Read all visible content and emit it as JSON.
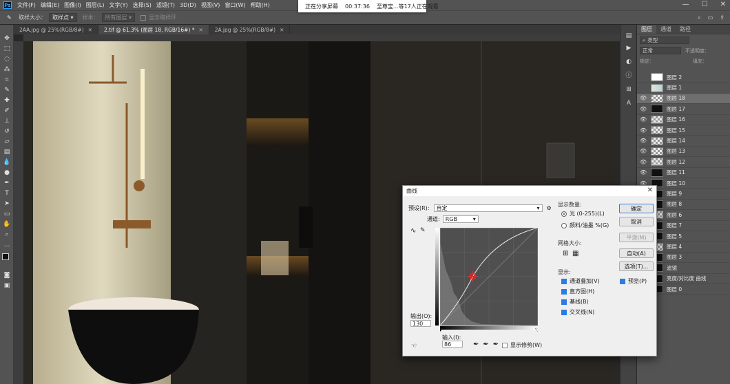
{
  "menu": [
    "文件(F)",
    "编辑(E)",
    "图像(I)",
    "图层(L)",
    "文字(Y)",
    "选择(S)",
    "滤镜(T)",
    "3D(D)",
    "视图(V)",
    "窗口(W)",
    "帮助(H)"
  ],
  "share": {
    "status": "正在分享屏幕",
    "timer": "00:37:36",
    "viewers": "至尊宝...等17人正在观看"
  },
  "options": {
    "sample_size_label": "取样大小：",
    "sample_size_value": "取样点",
    "sample_label": "样本：",
    "sample_value": "所有图层",
    "show_ring": "显示取样环"
  },
  "tabs": [
    {
      "label": "2AA.jpg @ 25%(RGB/8#)"
    },
    {
      "label": "2.tif @ 61.3% (图层 18, RGB/16#) *"
    },
    {
      "label": "2A.jpg @ 25%(RGB/8#)"
    }
  ],
  "layers_panel": {
    "tabs": [
      "图层",
      "通道",
      "路径"
    ],
    "filter": "类型",
    "blend_mode": "正常",
    "opacity_label": "不透明度：",
    "lock_label": "锁定：",
    "fill_label": "填充：",
    "layers": [
      {
        "name": "图层 2",
        "visible": false,
        "thumb": "white"
      },
      {
        "name": "图层 1",
        "visible": false,
        "thumb": "light"
      },
      {
        "name": "图层 18",
        "visible": true,
        "thumb": "check",
        "selected": true
      },
      {
        "name": "图层 17",
        "visible": true,
        "thumb": "dark"
      },
      {
        "name": "图层 16",
        "visible": true,
        "thumb": "check"
      },
      {
        "name": "图层 15",
        "visible": true,
        "thumb": "check"
      },
      {
        "name": "图层 14",
        "visible": true,
        "thumb": "check"
      },
      {
        "name": "图层 13",
        "visible": true,
        "thumb": "check"
      },
      {
        "name": "图层 12",
        "visible": true,
        "thumb": "check"
      },
      {
        "name": "图层 11",
        "visible": true,
        "thumb": "dark"
      },
      {
        "name": "图层 10",
        "visible": true,
        "thumb": "dark"
      },
      {
        "name": "图层 9",
        "visible": true,
        "thumb": "dark"
      },
      {
        "name": "图层 8",
        "visible": true,
        "thumb": "dark"
      },
      {
        "name": "图层 6",
        "visible": true,
        "thumb": "check"
      },
      {
        "name": "图层 7",
        "visible": true,
        "thumb": "dark"
      },
      {
        "name": "图层 5",
        "visible": true,
        "thumb": "dark"
      },
      {
        "name": "图层 4",
        "visible": true,
        "thumb": "check"
      },
      {
        "name": "图层 3",
        "visible": true,
        "thumb": "dark"
      },
      {
        "name": "滤镜",
        "visible": true,
        "thumb": "dark"
      },
      {
        "name": "亮度/对比度 曲线",
        "visible": true,
        "thumb": "dark"
      },
      {
        "name": "图层 0",
        "visible": true,
        "thumb": "dark"
      }
    ]
  },
  "curves": {
    "title": "曲线",
    "preset_label": "预设(R):",
    "preset_value": "自定",
    "channel_label": "通道:",
    "channel_value": "RGB",
    "output_label": "输出(O):",
    "output_value": "130",
    "input_label": "输入(I):",
    "input_value": "86",
    "show_clipping": "显示修剪(W)",
    "display_amount_label": "显示数量:",
    "light_option": "光 (0-255)(L)",
    "pigment_option": "颜料/油墨 %(G)",
    "grid_size_label": "网格大小:",
    "show_label": "显示:",
    "show_options": [
      "通道叠加(V)",
      "直方图(H)",
      "基线(B)",
      "交叉线(N)"
    ],
    "buttons": {
      "ok": "确定",
      "cancel": "取消",
      "smooth": "平滑(M)",
      "auto": "自动(A)",
      "options": "选项(T)..."
    },
    "preview": "预览(P)"
  },
  "colors": {
    "ui_dark": "#535353",
    "canvas_bg": "#282828",
    "accent": "#2d7be5",
    "curve_point": "#e03030"
  },
  "icons": [
    "eyedropper-icon",
    "move-icon",
    "marquee-icon",
    "lasso-icon",
    "crop-icon",
    "brush-icon",
    "eraser-icon",
    "type-icon",
    "hand-icon",
    "zoom-icon",
    "eye-icon",
    "gear-icon",
    "close-icon"
  ]
}
